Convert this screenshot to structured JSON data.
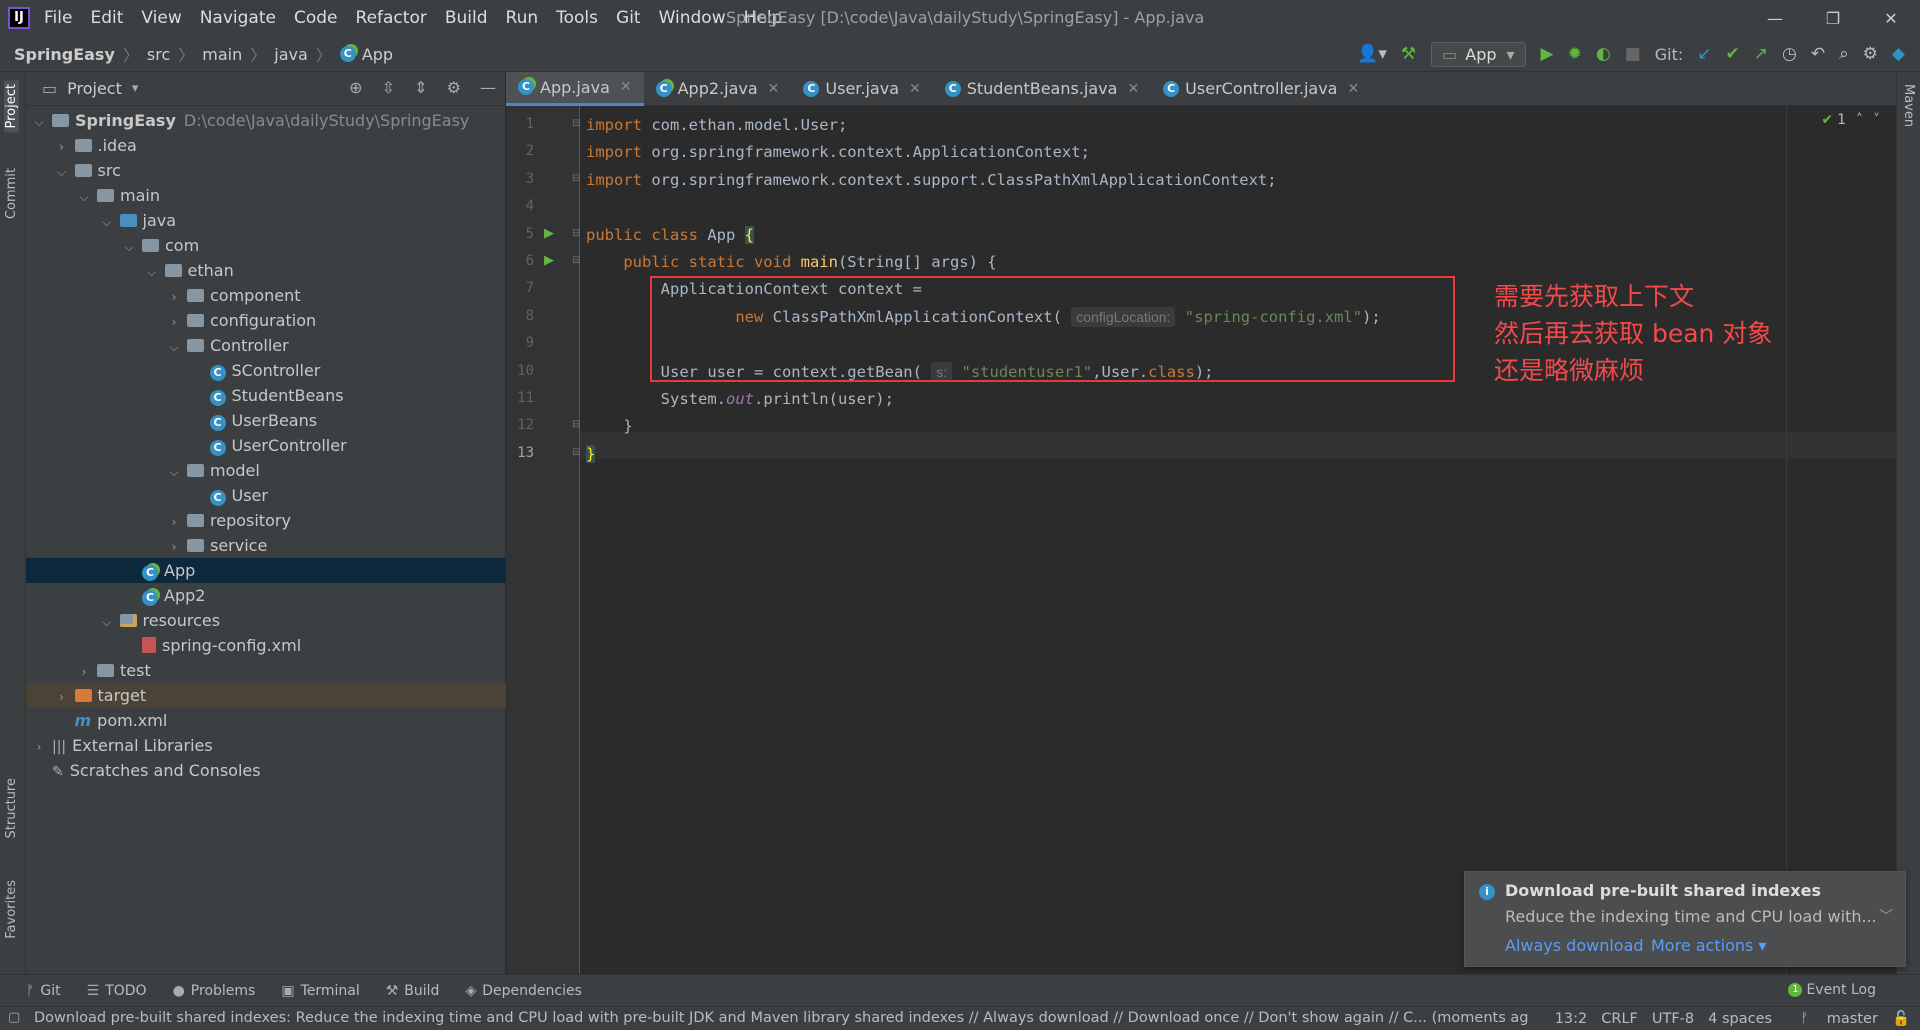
{
  "window": {
    "title": "SpringEasy [D:\\code\\Java\\dailyStudy\\SpringEasy] - App.java",
    "logo": "IJ",
    "controls": [
      "—",
      "❐",
      "✕"
    ]
  },
  "menu": [
    "File",
    "Edit",
    "View",
    "Navigate",
    "Code",
    "Refactor",
    "Build",
    "Run",
    "Tools",
    "Git",
    "Window",
    "Help"
  ],
  "breadcrumb": [
    "SpringEasy",
    "src",
    "main",
    "java",
    "App"
  ],
  "toolbar": {
    "run_config": "App",
    "git_label": "Git:"
  },
  "left_stripe": [
    "Project",
    "Commit",
    "Structure",
    "Favorites"
  ],
  "right_stripe": [
    "Maven"
  ],
  "project_panel": {
    "title": "Project",
    "tree": [
      {
        "label": "SpringEasy",
        "path": "D:\\code\\Java\\dailyStudy\\SpringEasy",
        "depth": 0,
        "arrow": "v",
        "icon": "folder-module"
      },
      {
        "label": ".idea",
        "depth": 1,
        "arrow": ">",
        "icon": "folder"
      },
      {
        "label": "src",
        "depth": 1,
        "arrow": "v",
        "icon": "folder"
      },
      {
        "label": "main",
        "depth": 2,
        "arrow": "v",
        "icon": "folder"
      },
      {
        "label": "java",
        "depth": 3,
        "arrow": "v",
        "icon": "folder-blue"
      },
      {
        "label": "com",
        "depth": 4,
        "arrow": "v",
        "icon": "folder"
      },
      {
        "label": "ethan",
        "depth": 5,
        "arrow": "v",
        "icon": "folder"
      },
      {
        "label": "component",
        "depth": 6,
        "arrow": ">",
        "icon": "folder"
      },
      {
        "label": "configuration",
        "depth": 6,
        "arrow": ">",
        "icon": "folder"
      },
      {
        "label": "Controller",
        "depth": 6,
        "arrow": "v",
        "icon": "folder"
      },
      {
        "label": "SController",
        "depth": 7,
        "arrow": "",
        "icon": "class"
      },
      {
        "label": "StudentBeans",
        "depth": 7,
        "arrow": "",
        "icon": "class"
      },
      {
        "label": "UserBeans",
        "depth": 7,
        "arrow": "",
        "icon": "class"
      },
      {
        "label": "UserController",
        "depth": 7,
        "arrow": "",
        "icon": "class"
      },
      {
        "label": "model",
        "depth": 6,
        "arrow": "v",
        "icon": "folder"
      },
      {
        "label": "User",
        "depth": 7,
        "arrow": "",
        "icon": "class"
      },
      {
        "label": "repository",
        "depth": 6,
        "arrow": ">",
        "icon": "folder"
      },
      {
        "label": "service",
        "depth": 6,
        "arrow": ">",
        "icon": "folder"
      },
      {
        "label": "App",
        "depth": 4,
        "arrow": "",
        "icon": "class-run",
        "selected": true
      },
      {
        "label": "App2",
        "depth": 4,
        "arrow": "",
        "icon": "class-run"
      },
      {
        "label": "resources",
        "depth": 3,
        "arrow": "v",
        "icon": "folder-res"
      },
      {
        "label": "spring-config.xml",
        "depth": 4,
        "arrow": "",
        "icon": "xml"
      },
      {
        "label": "test",
        "depth": 2,
        "arrow": ">",
        "icon": "folder"
      },
      {
        "label": "target",
        "depth": 1,
        "arrow": ">",
        "icon": "folder-orange",
        "excluded": true
      },
      {
        "label": "pom.xml",
        "depth": 1,
        "arrow": "",
        "icon": "maven"
      },
      {
        "label": "External Libraries",
        "depth": 0,
        "arrow": ">",
        "icon": "library"
      },
      {
        "label": "Scratches and Consoles",
        "depth": 0,
        "arrow": "",
        "icon": "scratch"
      }
    ]
  },
  "tabs": [
    {
      "label": "App.java",
      "active": true
    },
    {
      "label": "App2.java"
    },
    {
      "label": "User.java"
    },
    {
      "label": "StudentBeans.java"
    },
    {
      "label": "UserController.java"
    }
  ],
  "editor": {
    "inspection_count": "1",
    "current_line": 13,
    "lines": [
      {
        "n": "1",
        "tokens": [
          [
            "kw",
            "import "
          ],
          [
            "",
            "com.ethan.model.User;"
          ]
        ]
      },
      {
        "n": "2",
        "tokens": [
          [
            "kw",
            "import "
          ],
          [
            "",
            "org.springframework.context.ApplicationContext;"
          ]
        ]
      },
      {
        "n": "3",
        "tokens": [
          [
            "kw",
            "import "
          ],
          [
            "",
            "org.springframework.context.support.ClassPathXmlApplicationContext;"
          ]
        ]
      },
      {
        "n": "4",
        "tokens": []
      },
      {
        "n": "5",
        "tokens": [
          [
            "kw",
            "public class "
          ],
          [
            "",
            "App "
          ],
          [
            "brace",
            "{"
          ]
        ],
        "run": true
      },
      {
        "n": "6",
        "tokens": [
          [
            "",
            "    "
          ],
          [
            "kw",
            "public static void "
          ],
          [
            "fn",
            "main"
          ],
          [
            "",
            "(String[] args) {"
          ]
        ],
        "run": true
      },
      {
        "n": "7",
        "tokens": [
          [
            "",
            "        ApplicationContext context ="
          ]
        ]
      },
      {
        "n": "8",
        "tokens": [
          [
            "",
            "                "
          ],
          [
            "kw",
            "new "
          ],
          [
            "",
            "ClassPathXmlApplicationContext( "
          ],
          [
            "hint",
            "configLocation:"
          ],
          [
            "str",
            " \"spring-config.xml\""
          ],
          [
            "",
            ");"
          ]
        ]
      },
      {
        "n": "9",
        "tokens": []
      },
      {
        "n": "10",
        "tokens": [
          [
            "",
            "        User user = context.getBean( "
          ],
          [
            "hint",
            "s:"
          ],
          [
            "str",
            " \"studentuser1\""
          ],
          [
            "",
            ","
          ],
          [
            "",
            "User."
          ],
          [
            "kw",
            "class"
          ],
          [
            "",
            ");"
          ]
        ]
      },
      {
        "n": "11",
        "tokens": [
          [
            "",
            "        System."
          ],
          [
            "it",
            "out"
          ],
          [
            "",
            ".println(user);"
          ]
        ]
      },
      {
        "n": "12",
        "tokens": [
          [
            "",
            "    }"
          ]
        ]
      },
      {
        "n": "13",
        "tokens": [
          [
            "brace",
            "}"
          ]
        ]
      }
    ],
    "annotation": "需要先获取上下文\n然后再去获取 bean 对象\n还是略微麻烦"
  },
  "notification": {
    "title": "Download pre-built shared indexes",
    "body": "Reduce the indexing time and CPU load with...",
    "action_primary": "Always download",
    "action_more": "More actions ▾"
  },
  "bottom_tools": [
    {
      "icon": "git-icon",
      "glyph": "ᚠ",
      "label": "Git"
    },
    {
      "icon": "todo-icon",
      "glyph": "☰",
      "label": "TODO"
    },
    {
      "icon": "problems-icon",
      "glyph": "●",
      "label": "Problems"
    },
    {
      "icon": "terminal-icon",
      "glyph": "▣",
      "label": "Terminal"
    },
    {
      "icon": "build-icon",
      "glyph": "⚒",
      "label": "Build"
    },
    {
      "icon": "dependencies-icon",
      "glyph": "◈",
      "label": "Dependencies"
    }
  ],
  "event_log": {
    "label": "Event Log",
    "count": "1"
  },
  "status": {
    "message": "Download pre-built shared indexes: Reduce the indexing time and CPU load with pre-built JDK and Maven library shared indexes // Always download // Download once // Don't show again // C... (moments ag",
    "position": "13:2",
    "line_sep": "CRLF",
    "encoding": "UTF-8",
    "indent": "4 spaces",
    "branch": "master"
  },
  "colors": {
    "accent": "#4a88c7",
    "annotation_red": "#e83a3a",
    "selection": "#0d293e"
  }
}
